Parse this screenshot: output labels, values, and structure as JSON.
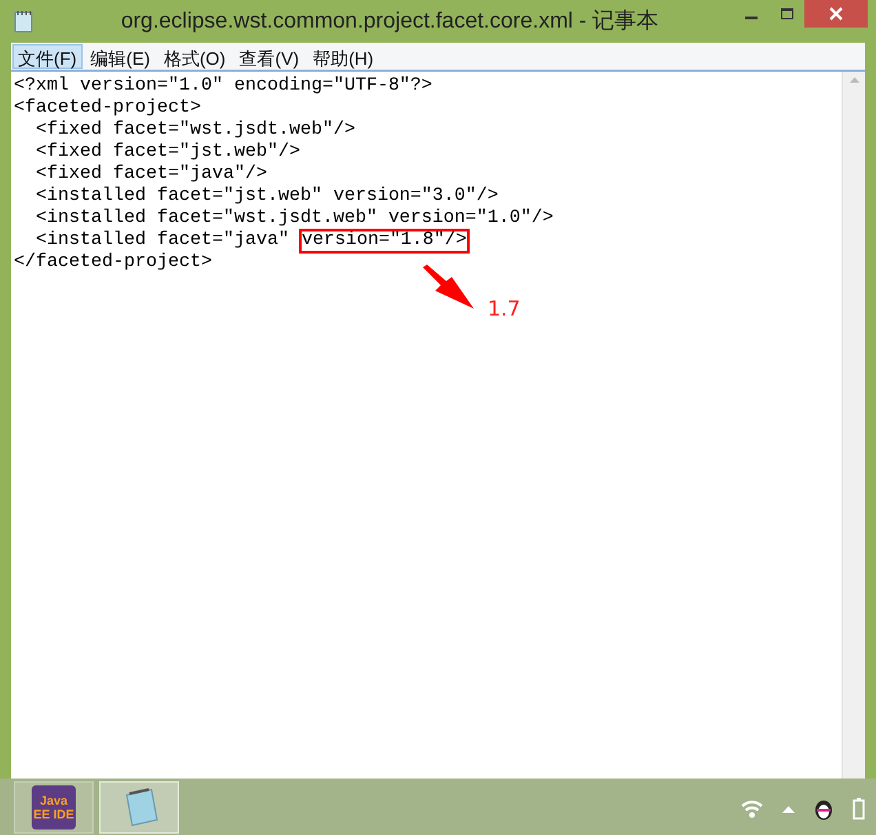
{
  "window": {
    "title": "org.eclipse.wst.common.project.facet.core.xml - 记事本"
  },
  "menu": [
    {
      "label": "文件(F)",
      "selected": true
    },
    {
      "label": "编辑(E)",
      "selected": false
    },
    {
      "label": "格式(O)",
      "selected": false
    },
    {
      "label": "查看(V)",
      "selected": false
    },
    {
      "label": "帮助(H)",
      "selected": false
    }
  ],
  "editor": {
    "lines": [
      {
        "text": "<?xml version=\"1.0\" encoding=\"UTF-8\"?>"
      },
      {
        "text": "<faceted-project>"
      },
      {
        "text": "  <fixed facet=\"wst.jsdt.web\"/>"
      },
      {
        "text": "  <fixed facet=\"jst.web\"/>"
      },
      {
        "text": "  <fixed facet=\"java\"/>"
      },
      {
        "text": "  <installed facet=\"jst.web\" version=\"3.0\"/>"
      },
      {
        "text": "  <installed facet=\"wst.jsdt.web\" version=\"1.0\"/>"
      },
      {
        "text": "  <installed facet=\"java\" ",
        "highlight": "version=\"1.8\"/>"
      },
      {
        "text": "</faceted-project>"
      }
    ],
    "annotation": {
      "label": "1.7"
    }
  },
  "taskbar": {
    "apps": [
      {
        "label": "Java EE IDE",
        "selected": false
      },
      {
        "kind": "notepad",
        "selected": true
      }
    ]
  }
}
